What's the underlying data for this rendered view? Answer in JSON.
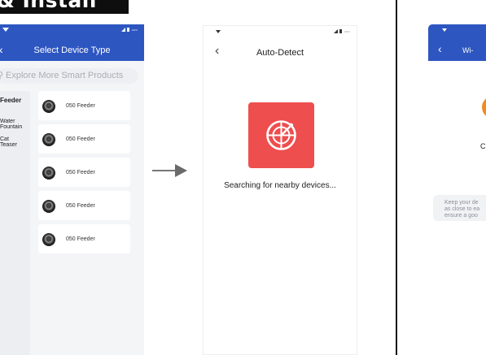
{
  "banner": {
    "text": "& Install"
  },
  "screen1": {
    "title": "Select Device Type",
    "search_placeholder": "Explore More Smart Products",
    "categories": [
      "Feeder",
      "Water Fountain",
      "Cat Teaser"
    ],
    "products": [
      "050 Feeder",
      "050 Feeder",
      "050 Feeder",
      "050 Feeder",
      "050 Feeder"
    ],
    "status_battery": "100%"
  },
  "screen2": {
    "title": "Auto-Detect",
    "status_text": "Searching for nearby devices...",
    "status_battery": "100%"
  },
  "screen3": {
    "title_fragment": "Wi-",
    "label_fragment": "C",
    "tip_lines": [
      "Keep your de",
      "as close to ea",
      "ensure a goo"
    ]
  },
  "colors": {
    "header_blue": "#2d56c1",
    "radar_red": "#ee4e4e",
    "accent_orange": "#f08c22"
  }
}
